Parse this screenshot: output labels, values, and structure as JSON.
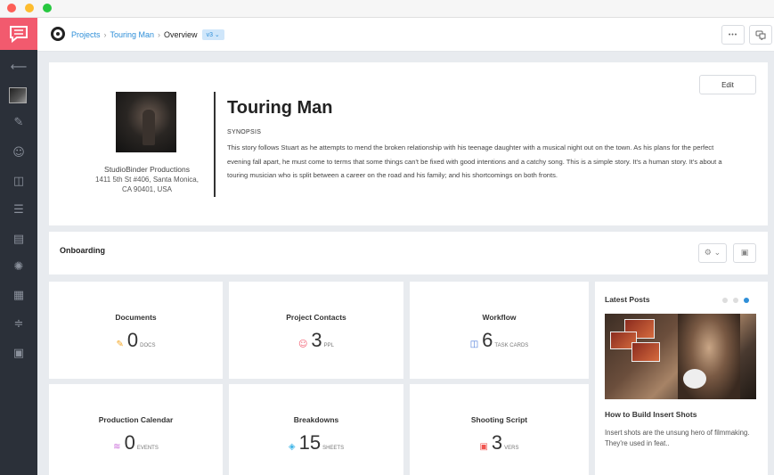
{
  "breadcrumb": {
    "projects": "Projects",
    "project": "Touring Man",
    "current": "Overview",
    "version": "v3 ⌄"
  },
  "topbar": {
    "more_icon": "ellipsis-icon",
    "more_label": "•••",
    "chat_icon": "chat-icon",
    "chat_label": "◯"
  },
  "project": {
    "title": "Touring Man",
    "synopsis_label": "SYNOPSIS",
    "synopsis": "This story follows Stuart as he attempts to mend the broken relationship with his teenage daughter with a musical night out on the town. As his plans for the perfect evening fall apart, he must come to terms that some things can't be fixed with good intentions and a catchy song. This is a simple story. It's a human story. It's about a touring musician who is split between a career on the road and his family; and his shortcomings on both fronts.",
    "edit_label": "Edit",
    "company_name": "StudioBinder Productions",
    "company_address_1": "1411 5th St #406, Santa Monica,",
    "company_address_2": "CA 90401, USA"
  },
  "onboarding": {
    "title": "Onboarding",
    "settings_label": "⚙ ⌄",
    "layout_label": "▣"
  },
  "stats": [
    {
      "title": "Documents",
      "count": "0",
      "unit": "DOCS",
      "icon": "pencil-icon",
      "glyph": "✎",
      "color": "#f5a623"
    },
    {
      "title": "Project Contacts",
      "count": "3",
      "unit": "PPL",
      "icon": "contacts-icon",
      "glyph": "☺",
      "color": "#f25a6e"
    },
    {
      "title": "Workflow",
      "count": "6",
      "unit": "TASK CARDS",
      "icon": "board-icon",
      "glyph": "◫",
      "color": "#4a79d8"
    },
    {
      "title": "Production Calendar",
      "count": "0",
      "unit": "EVENTS",
      "icon": "calendar-icon",
      "glyph": "≋",
      "color": "#c86ad8"
    },
    {
      "title": "Breakdowns",
      "count": "15",
      "unit": "SHEETS",
      "icon": "layers-icon",
      "glyph": "◈",
      "color": "#3fb5e8"
    },
    {
      "title": "Shooting Script",
      "count": "3",
      "unit": "VERS",
      "icon": "script-icon",
      "glyph": "▣",
      "color": "#f0544f"
    }
  ],
  "latest_posts": {
    "title": "Latest Posts",
    "post_title": "How to Build Insert Shots",
    "post_excerpt": "Insert shots are the unsung hero of filmmaking. They're used in feat..",
    "active_dot_color": "#2f8fd8"
  },
  "sidebar": {
    "icons": [
      "back-arrow-icon",
      "project-thumbnail",
      "pencil-icon",
      "contacts-icon",
      "board-icon",
      "tasks-icon",
      "list-icon",
      "reel-icon",
      "calendar-icon",
      "sliders-icon",
      "video-icon"
    ]
  }
}
